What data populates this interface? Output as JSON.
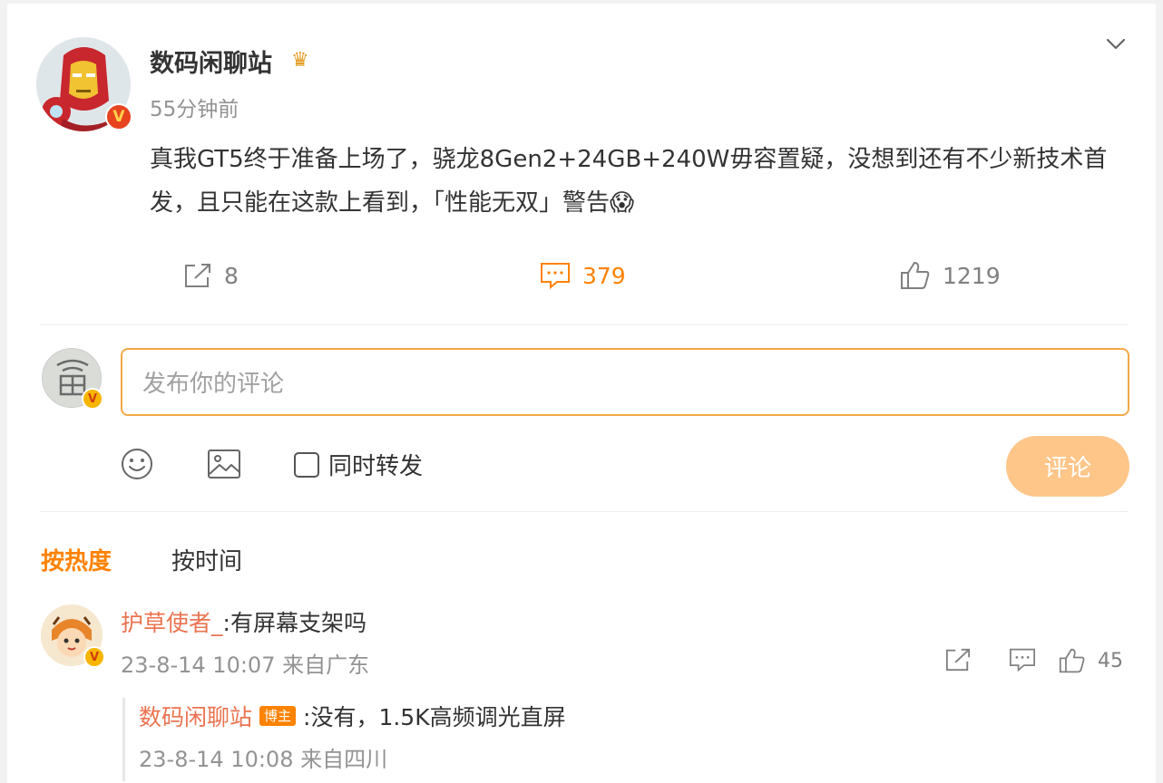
{
  "colors": {
    "accent": "#ff8200",
    "username": "#eb7350",
    "muted": "#939393",
    "button_disabled": "#ffc68a"
  },
  "icons": [
    "chevron-down-icon",
    "share-icon",
    "comment-icon",
    "like-icon",
    "emoji-icon",
    "image-icon"
  ],
  "post": {
    "author": "数码闲聊站",
    "time": "55分钟前",
    "text": "真我GT5终于准备上场了，骁龙8Gen2+24GB+240W毋容置疑，没想到还有不少新技术首发，且只能在这款上看到，「性能无双」警告😱",
    "share_count": "8",
    "comment_count": "379",
    "like_count": "1219"
  },
  "composer": {
    "placeholder": "发布你的评论",
    "repost_label": "同时转发",
    "submit_label": "评论"
  },
  "sort": {
    "hot": "按热度",
    "time": "按时间"
  },
  "comments": [
    {
      "user": "护草使者_",
      "text": ":有屏幕支架吗",
      "meta": "23-8-14 10:07 来自广东",
      "like_count": "45",
      "reply": {
        "user": "数码闲聊站",
        "tag": "博主",
        "text": ":没有，1.5K高频调光直屏",
        "meta": "23-8-14 10:08 来自四川"
      }
    }
  ]
}
